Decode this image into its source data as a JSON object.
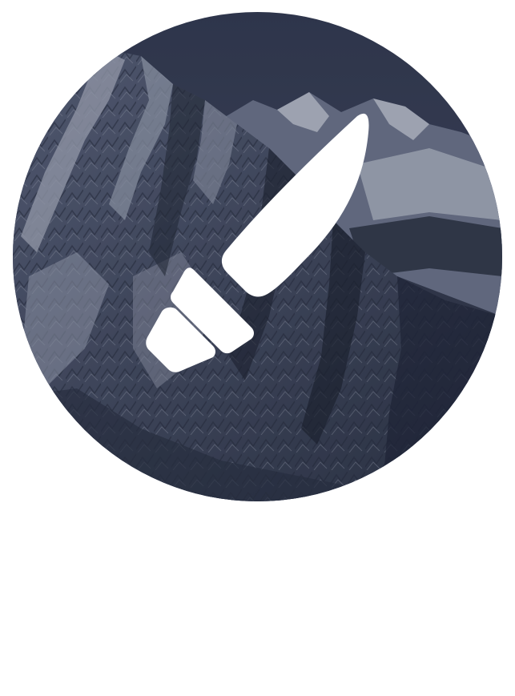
{
  "emblem": {
    "icon": "knife-icon",
    "background_image": "snowy-mountain-photo",
    "colors": {
      "sky": "#39405a",
      "shadow": "#1e2434",
      "rock": "#4e5672",
      "snow": "#9ea5b8",
      "snow_bright": "#c4c9d6",
      "icon_fill": "#ffffff"
    }
  }
}
